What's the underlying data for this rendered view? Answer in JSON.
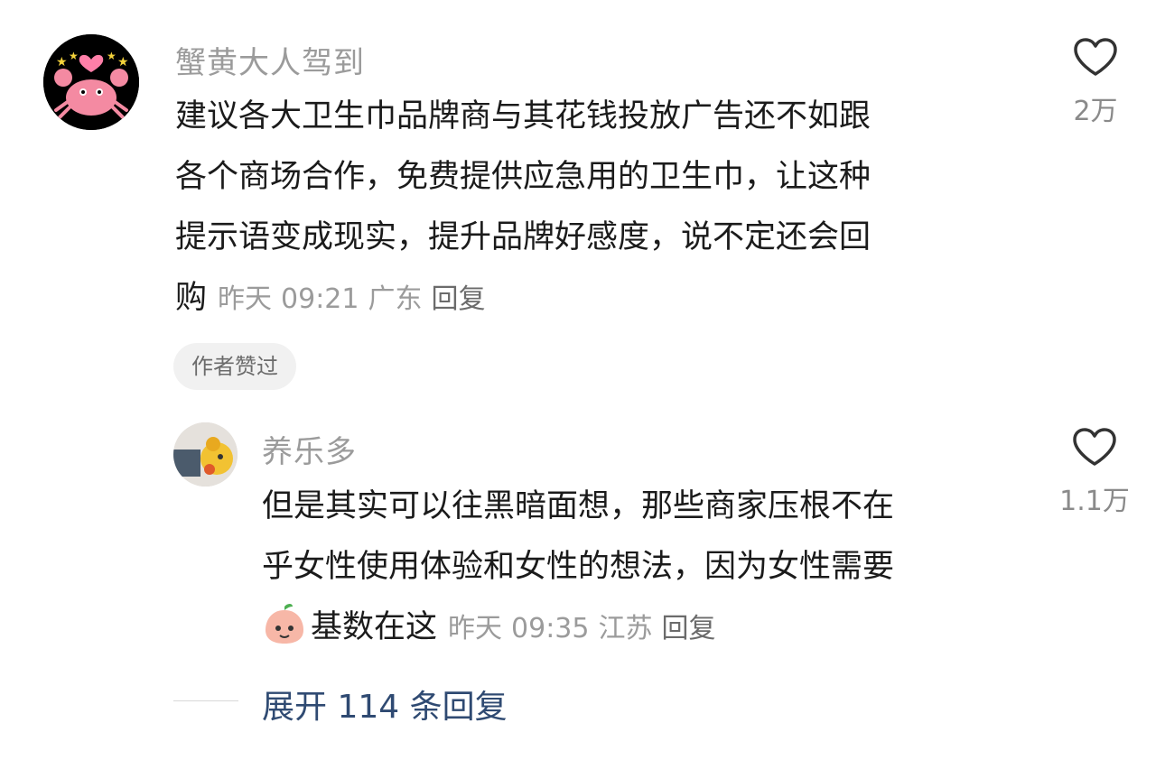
{
  "top_comment": {
    "username": "蟹黄大人驾到",
    "lines": [
      "建议各大卫生巾品牌商与其花钱投放广告还不如跟",
      "各个商场合作，免费提供应急用的卫生巾，让这种",
      "提示语变成现实，提升品牌好感度，说不定还会回",
      "购"
    ],
    "date": "昨天",
    "time": "09:21",
    "location": "广东",
    "reply_label": "回复",
    "like_count": "2万",
    "badge": "作者赞过"
  },
  "reply_comment": {
    "username": "养乐多",
    "lines": [
      "但是其实可以往黑暗面想，那些商家压根不在",
      "乎女性使用体验和女性的想法，因为女性需要",
      "基数在这"
    ],
    "date": "昨天",
    "time": "09:35",
    "location": "江苏",
    "reply_label": "回复",
    "like_count": "1.1万"
  },
  "expand_replies": "展开 114 条回复"
}
